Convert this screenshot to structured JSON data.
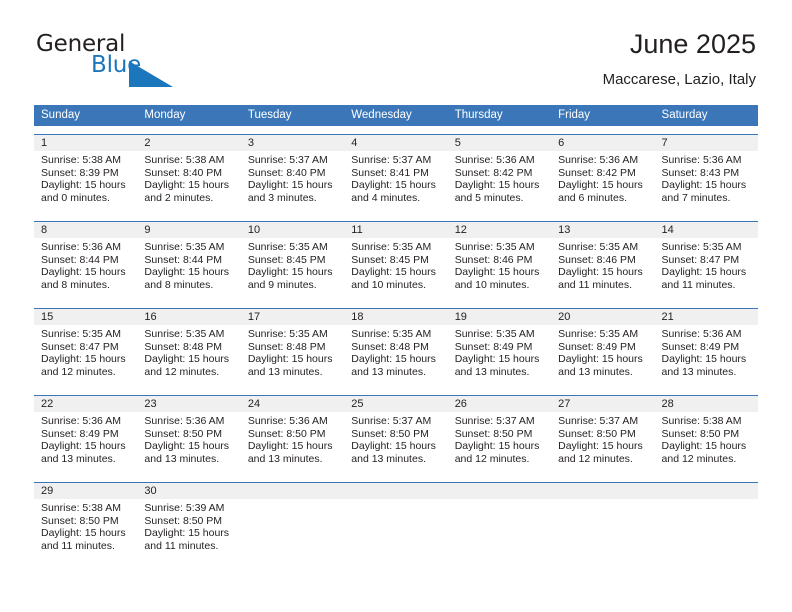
{
  "brand": {
    "name_part1": "General",
    "name_part2": "Blue",
    "logo_icon": "triangle-flag-icon",
    "accent_color": "#1c76bc"
  },
  "header": {
    "title": "June 2025",
    "subtitle": "Maccarese, Lazio, Italy"
  },
  "calendar": {
    "header_bg": "#3b77b8",
    "daynum_bg": "#f0f0f0",
    "weekday_headers": [
      "Sunday",
      "Monday",
      "Tuesday",
      "Wednesday",
      "Thursday",
      "Friday",
      "Saturday"
    ],
    "weeks": [
      [
        {
          "day": "1",
          "sunrise": "Sunrise: 5:38 AM",
          "sunset": "Sunset: 8:39 PM",
          "daylight1": "Daylight: 15 hours",
          "daylight2": "and 0 minutes."
        },
        {
          "day": "2",
          "sunrise": "Sunrise: 5:38 AM",
          "sunset": "Sunset: 8:40 PM",
          "daylight1": "Daylight: 15 hours",
          "daylight2": "and 2 minutes."
        },
        {
          "day": "3",
          "sunrise": "Sunrise: 5:37 AM",
          "sunset": "Sunset: 8:40 PM",
          "daylight1": "Daylight: 15 hours",
          "daylight2": "and 3 minutes."
        },
        {
          "day": "4",
          "sunrise": "Sunrise: 5:37 AM",
          "sunset": "Sunset: 8:41 PM",
          "daylight1": "Daylight: 15 hours",
          "daylight2": "and 4 minutes."
        },
        {
          "day": "5",
          "sunrise": "Sunrise: 5:36 AM",
          "sunset": "Sunset: 8:42 PM",
          "daylight1": "Daylight: 15 hours",
          "daylight2": "and 5 minutes."
        },
        {
          "day": "6",
          "sunrise": "Sunrise: 5:36 AM",
          "sunset": "Sunset: 8:42 PM",
          "daylight1": "Daylight: 15 hours",
          "daylight2": "and 6 minutes."
        },
        {
          "day": "7",
          "sunrise": "Sunrise: 5:36 AM",
          "sunset": "Sunset: 8:43 PM",
          "daylight1": "Daylight: 15 hours",
          "daylight2": "and 7 minutes."
        }
      ],
      [
        {
          "day": "8",
          "sunrise": "Sunrise: 5:36 AM",
          "sunset": "Sunset: 8:44 PM",
          "daylight1": "Daylight: 15 hours",
          "daylight2": "and 8 minutes."
        },
        {
          "day": "9",
          "sunrise": "Sunrise: 5:35 AM",
          "sunset": "Sunset: 8:44 PM",
          "daylight1": "Daylight: 15 hours",
          "daylight2": "and 8 minutes."
        },
        {
          "day": "10",
          "sunrise": "Sunrise: 5:35 AM",
          "sunset": "Sunset: 8:45 PM",
          "daylight1": "Daylight: 15 hours",
          "daylight2": "and 9 minutes."
        },
        {
          "day": "11",
          "sunrise": "Sunrise: 5:35 AM",
          "sunset": "Sunset: 8:45 PM",
          "daylight1": "Daylight: 15 hours",
          "daylight2": "and 10 minutes."
        },
        {
          "day": "12",
          "sunrise": "Sunrise: 5:35 AM",
          "sunset": "Sunset: 8:46 PM",
          "daylight1": "Daylight: 15 hours",
          "daylight2": "and 10 minutes."
        },
        {
          "day": "13",
          "sunrise": "Sunrise: 5:35 AM",
          "sunset": "Sunset: 8:46 PM",
          "daylight1": "Daylight: 15 hours",
          "daylight2": "and 11 minutes."
        },
        {
          "day": "14",
          "sunrise": "Sunrise: 5:35 AM",
          "sunset": "Sunset: 8:47 PM",
          "daylight1": "Daylight: 15 hours",
          "daylight2": "and 11 minutes."
        }
      ],
      [
        {
          "day": "15",
          "sunrise": "Sunrise: 5:35 AM",
          "sunset": "Sunset: 8:47 PM",
          "daylight1": "Daylight: 15 hours",
          "daylight2": "and 12 minutes."
        },
        {
          "day": "16",
          "sunrise": "Sunrise: 5:35 AM",
          "sunset": "Sunset: 8:48 PM",
          "daylight1": "Daylight: 15 hours",
          "daylight2": "and 12 minutes."
        },
        {
          "day": "17",
          "sunrise": "Sunrise: 5:35 AM",
          "sunset": "Sunset: 8:48 PM",
          "daylight1": "Daylight: 15 hours",
          "daylight2": "and 13 minutes."
        },
        {
          "day": "18",
          "sunrise": "Sunrise: 5:35 AM",
          "sunset": "Sunset: 8:48 PM",
          "daylight1": "Daylight: 15 hours",
          "daylight2": "and 13 minutes."
        },
        {
          "day": "19",
          "sunrise": "Sunrise: 5:35 AM",
          "sunset": "Sunset: 8:49 PM",
          "daylight1": "Daylight: 15 hours",
          "daylight2": "and 13 minutes."
        },
        {
          "day": "20",
          "sunrise": "Sunrise: 5:35 AM",
          "sunset": "Sunset: 8:49 PM",
          "daylight1": "Daylight: 15 hours",
          "daylight2": "and 13 minutes."
        },
        {
          "day": "21",
          "sunrise": "Sunrise: 5:36 AM",
          "sunset": "Sunset: 8:49 PM",
          "daylight1": "Daylight: 15 hours",
          "daylight2": "and 13 minutes."
        }
      ],
      [
        {
          "day": "22",
          "sunrise": "Sunrise: 5:36 AM",
          "sunset": "Sunset: 8:49 PM",
          "daylight1": "Daylight: 15 hours",
          "daylight2": "and 13 minutes."
        },
        {
          "day": "23",
          "sunrise": "Sunrise: 5:36 AM",
          "sunset": "Sunset: 8:50 PM",
          "daylight1": "Daylight: 15 hours",
          "daylight2": "and 13 minutes."
        },
        {
          "day": "24",
          "sunrise": "Sunrise: 5:36 AM",
          "sunset": "Sunset: 8:50 PM",
          "daylight1": "Daylight: 15 hours",
          "daylight2": "and 13 minutes."
        },
        {
          "day": "25",
          "sunrise": "Sunrise: 5:37 AM",
          "sunset": "Sunset: 8:50 PM",
          "daylight1": "Daylight: 15 hours",
          "daylight2": "and 13 minutes."
        },
        {
          "day": "26",
          "sunrise": "Sunrise: 5:37 AM",
          "sunset": "Sunset: 8:50 PM",
          "daylight1": "Daylight: 15 hours",
          "daylight2": "and 12 minutes."
        },
        {
          "day": "27",
          "sunrise": "Sunrise: 5:37 AM",
          "sunset": "Sunset: 8:50 PM",
          "daylight1": "Daylight: 15 hours",
          "daylight2": "and 12 minutes."
        },
        {
          "day": "28",
          "sunrise": "Sunrise: 5:38 AM",
          "sunset": "Sunset: 8:50 PM",
          "daylight1": "Daylight: 15 hours",
          "daylight2": "and 12 minutes."
        }
      ],
      [
        {
          "day": "29",
          "sunrise": "Sunrise: 5:38 AM",
          "sunset": "Sunset: 8:50 PM",
          "daylight1": "Daylight: 15 hours",
          "daylight2": "and 11 minutes."
        },
        {
          "day": "30",
          "sunrise": "Sunrise: 5:39 AM",
          "sunset": "Sunset: 8:50 PM",
          "daylight1": "Daylight: 15 hours",
          "daylight2": "and 11 minutes."
        },
        {
          "day": "",
          "sunrise": "",
          "sunset": "",
          "daylight1": "",
          "daylight2": ""
        },
        {
          "day": "",
          "sunrise": "",
          "sunset": "",
          "daylight1": "",
          "daylight2": ""
        },
        {
          "day": "",
          "sunrise": "",
          "sunset": "",
          "daylight1": "",
          "daylight2": ""
        },
        {
          "day": "",
          "sunrise": "",
          "sunset": "",
          "daylight1": "",
          "daylight2": ""
        },
        {
          "day": "",
          "sunrise": "",
          "sunset": "",
          "daylight1": "",
          "daylight2": ""
        }
      ]
    ]
  }
}
